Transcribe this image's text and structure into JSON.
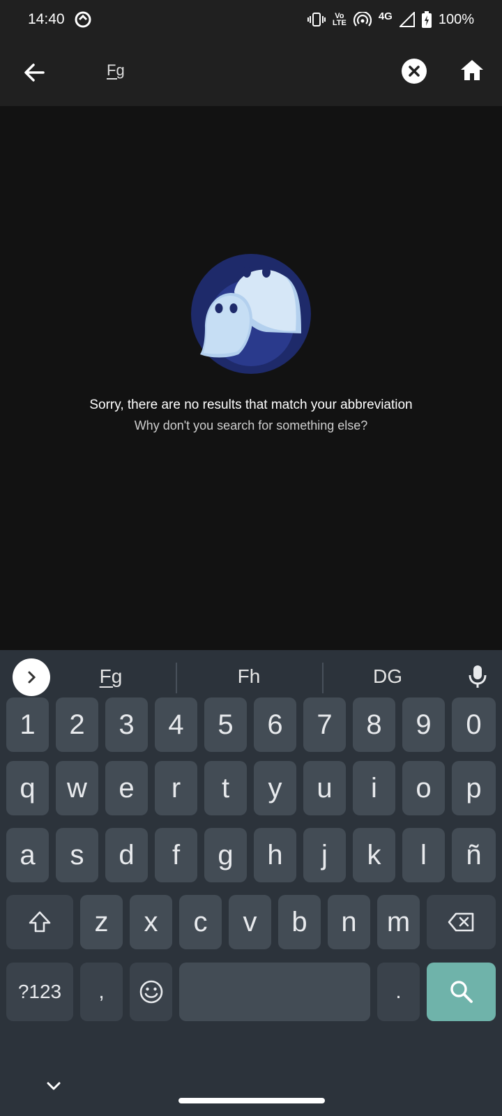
{
  "status_bar": {
    "time": "14:40",
    "network": "4G",
    "volte_top": "Vo",
    "volte_bottom": "LTE",
    "battery": "100%"
  },
  "app_bar": {
    "search_query": "Fg"
  },
  "empty_state": {
    "title": "Sorry, there are no results that match your abbreviation",
    "subtitle": "Why don't you search for something else?",
    "colors": {
      "circle": "#1e2a6a",
      "ghost": "#d6e7f7",
      "ghost_shadow": "#b3d0ee"
    }
  },
  "keyboard": {
    "suggestions": [
      "Fg",
      "Fh",
      "DG"
    ],
    "number_row": [
      "1",
      "2",
      "3",
      "4",
      "5",
      "6",
      "7",
      "8",
      "9",
      "0"
    ],
    "row1": [
      "q",
      "w",
      "e",
      "r",
      "t",
      "y",
      "u",
      "i",
      "o",
      "p"
    ],
    "row2": [
      "a",
      "s",
      "d",
      "f",
      "g",
      "h",
      "j",
      "k",
      "l",
      "ñ"
    ],
    "row3": [
      "z",
      "x",
      "c",
      "v",
      "b",
      "n",
      "m"
    ],
    "symbols_key": "?123",
    "comma_key": ",",
    "period_key": ".",
    "accent_color": "#6fb3aa"
  }
}
